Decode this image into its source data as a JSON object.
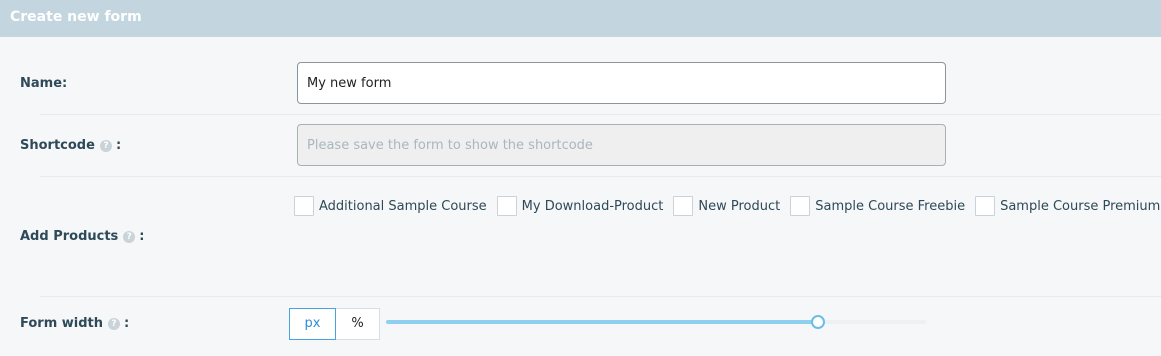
{
  "panel": {
    "title": "Create new form"
  },
  "name_row": {
    "label": "Name:",
    "value": "My new form"
  },
  "shortcode_row": {
    "label": "Shortcode",
    "suffix": ":",
    "help": "?",
    "placeholder": "Please save the form to show the shortcode"
  },
  "products_row": {
    "label": "Add Products",
    "suffix": ":",
    "help": "?",
    "products": [
      {
        "label": "Additional Sample Course",
        "checked": false
      },
      {
        "label": "My Download-Product",
        "checked": false
      },
      {
        "label": "New Product",
        "checked": false
      },
      {
        "label": "Sample Course Freebie",
        "checked": false
      },
      {
        "label": "Sample Course Premium",
        "checked": false
      }
    ]
  },
  "width_row": {
    "label": "Form width",
    "suffix": ":",
    "help": "?",
    "units": [
      "px",
      "%"
    ],
    "selected_unit": "px",
    "slider_fraction": 0.8
  },
  "colors": {
    "header_bg": "#c3d6df",
    "accent": "#2c8fd3",
    "slider": "#8fd0f1"
  }
}
